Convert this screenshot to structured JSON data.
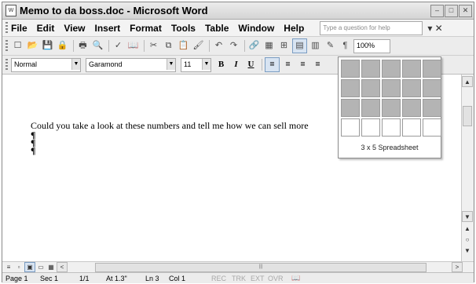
{
  "window": {
    "title": "Memo to da boss.doc - Microsoft Word",
    "doc_icon": "W",
    "buttons": [
      "–",
      "□",
      "✕"
    ]
  },
  "menubar": {
    "items": [
      "File",
      "Edit",
      "View",
      "Insert",
      "Format",
      "Tools",
      "Table",
      "Window",
      "Help"
    ],
    "help_placeholder": "Type a question for help",
    "close_glyph": "▾ ✕"
  },
  "toolbar": {
    "icons": [
      {
        "name": "new-document-icon",
        "glyph": "☐"
      },
      {
        "name": "open-icon",
        "glyph": "📂"
      },
      {
        "name": "save-icon",
        "glyph": "💾"
      },
      {
        "name": "permission-icon",
        "glyph": "🔒"
      },
      {
        "name": "print-icon",
        "glyph": "🖶"
      },
      {
        "name": "print-preview-icon",
        "glyph": "🔍"
      },
      {
        "name": "spelling-icon",
        "glyph": "✓"
      },
      {
        "name": "research-icon",
        "glyph": "📖"
      },
      {
        "name": "cut-icon",
        "glyph": "✂"
      },
      {
        "name": "copy-icon",
        "glyph": "⧉"
      },
      {
        "name": "paste-icon",
        "glyph": "📋"
      },
      {
        "name": "format-painter-icon",
        "glyph": "🖌"
      },
      {
        "name": "undo-icon",
        "glyph": "↶"
      },
      {
        "name": "redo-icon",
        "glyph": "↷"
      },
      {
        "name": "hyperlink-icon",
        "glyph": "🔗"
      },
      {
        "name": "tables-borders-icon",
        "glyph": "▦"
      },
      {
        "name": "insert-table-icon",
        "glyph": "⊞"
      },
      {
        "name": "insert-spreadsheet-icon",
        "glyph": "▤"
      },
      {
        "name": "columns-icon",
        "glyph": "▥"
      },
      {
        "name": "drawing-icon",
        "glyph": "✎"
      },
      {
        "name": "show-hide-icon",
        "glyph": "¶"
      }
    ],
    "zoom": "100%"
  },
  "format_bar": {
    "style": "Normal",
    "font": "Garamond",
    "size": "11",
    "bold": "B",
    "italic": "I",
    "underline": "U",
    "align_glyphs": [
      "≡",
      "≡",
      "≡",
      "≡"
    ]
  },
  "document": {
    "text": "Could you take a look at these numbers and tell me how we can sell more",
    "marks": [
      "¶",
      "¶",
      "¶"
    ]
  },
  "spreadsheet_picker": {
    "rows": 4,
    "cols": 5,
    "selected_rows": 3,
    "selected_cols": 5,
    "label": "3 x 5 Spreadsheet",
    "highlight_color": "#b4b4b4"
  },
  "view_buttons": [
    "≡",
    "▫",
    "▣",
    "▭",
    "▦"
  ],
  "hscroll": {
    "left_glyph": "<",
    "right_glyph": ">",
    "thumb_grip": "|||"
  },
  "vscroll": {
    "up": "▲",
    "down": "▼",
    "prev": "▲",
    "browse": "○",
    "next": "▼"
  },
  "status": {
    "page": "Page 1",
    "sec": "Sec 1",
    "pages": "1/1",
    "at": "At 1.3\"",
    "ln": "Ln 3",
    "col": "Col 1",
    "rec": "REC",
    "trk": "TRK",
    "ext": "EXT",
    "ovr": "OVR",
    "spell_icon": "📖"
  }
}
